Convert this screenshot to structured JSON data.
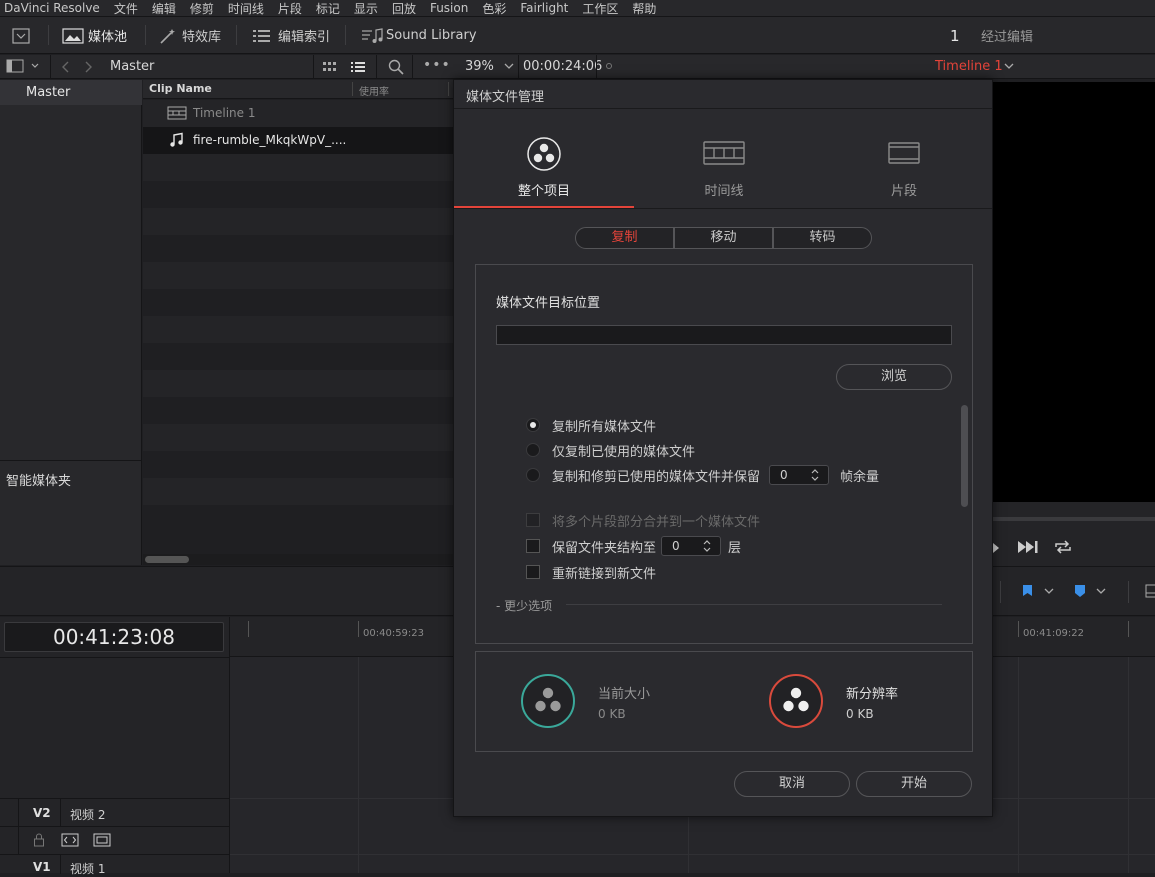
{
  "menu": [
    "DaVinci Resolve",
    "文件",
    "编辑",
    "修剪",
    "时间线",
    "片段",
    "标记",
    "显示",
    "回放",
    "Fusion",
    "色彩",
    "Fairlight",
    "工作区",
    "帮助"
  ],
  "toolbar": {
    "media_pool": "媒体池",
    "effects": "特效库",
    "edit_index": "编辑索引",
    "sound_library": "Sound Library",
    "page_number": "1",
    "page_name": "经过编辑"
  },
  "media_pool": {
    "bin_path": "Master",
    "bins_root": "Master",
    "smart_bins": "智能媒体夹",
    "columns": {
      "clip_name": "Clip Name",
      "usage": "使用率"
    },
    "clips": [
      {
        "name": "Timeline 1",
        "icon": "timeline-icon"
      },
      {
        "name": "fire-rumble_MkqkWpV_....",
        "icon": "music-note-icon"
      }
    ]
  },
  "viewer": {
    "zoom": "39%",
    "timecode": "00:00:24:06",
    "timeline_name": "Timeline 1"
  },
  "timeline": {
    "timecode": "00:41:23:08",
    "ruler_marks": [
      "00:40:59:23",
      "00:41:09:22"
    ],
    "tracks": [
      {
        "id": "V2",
        "name": "视频 2"
      },
      {
        "id": "V1",
        "name": "视频 1"
      }
    ]
  },
  "dialog": {
    "title": "媒体文件管理",
    "tabs": [
      {
        "label": "整个项目",
        "active": true
      },
      {
        "label": "时间线",
        "active": false
      },
      {
        "label": "片段",
        "active": false
      }
    ],
    "modes": [
      {
        "label": "复制",
        "active": true
      },
      {
        "label": "移动",
        "active": false
      },
      {
        "label": "转码",
        "active": false
      }
    ],
    "dest_label": "媒体文件目标位置",
    "dest_value": "",
    "browse": "浏览",
    "options": {
      "copy_all": "复制所有媒体文件",
      "copy_used": "仅复制已使用的媒体文件",
      "copy_trim": "复制和修剪已使用的媒体文件并保留",
      "handles_value": "0",
      "handles_unit": "帧余量",
      "combine": "将多个片段部分合并到一个媒体文件",
      "preserve_folders": "保留文件夹结构至",
      "folder_levels": "0",
      "levels_unit": "层",
      "relink": "重新链接到新文件",
      "fewer": "- 更少选项"
    },
    "summary": {
      "current_size_label": "当前大小",
      "current_size_value": "0 KB",
      "new_res_label": "新分辨率",
      "new_res_value": "0 KB"
    },
    "cancel": "取消",
    "start": "开始"
  },
  "colors": {
    "accent": "#e4443a",
    "teal": "#3aa89a",
    "red_ring": "#d94a3c"
  }
}
